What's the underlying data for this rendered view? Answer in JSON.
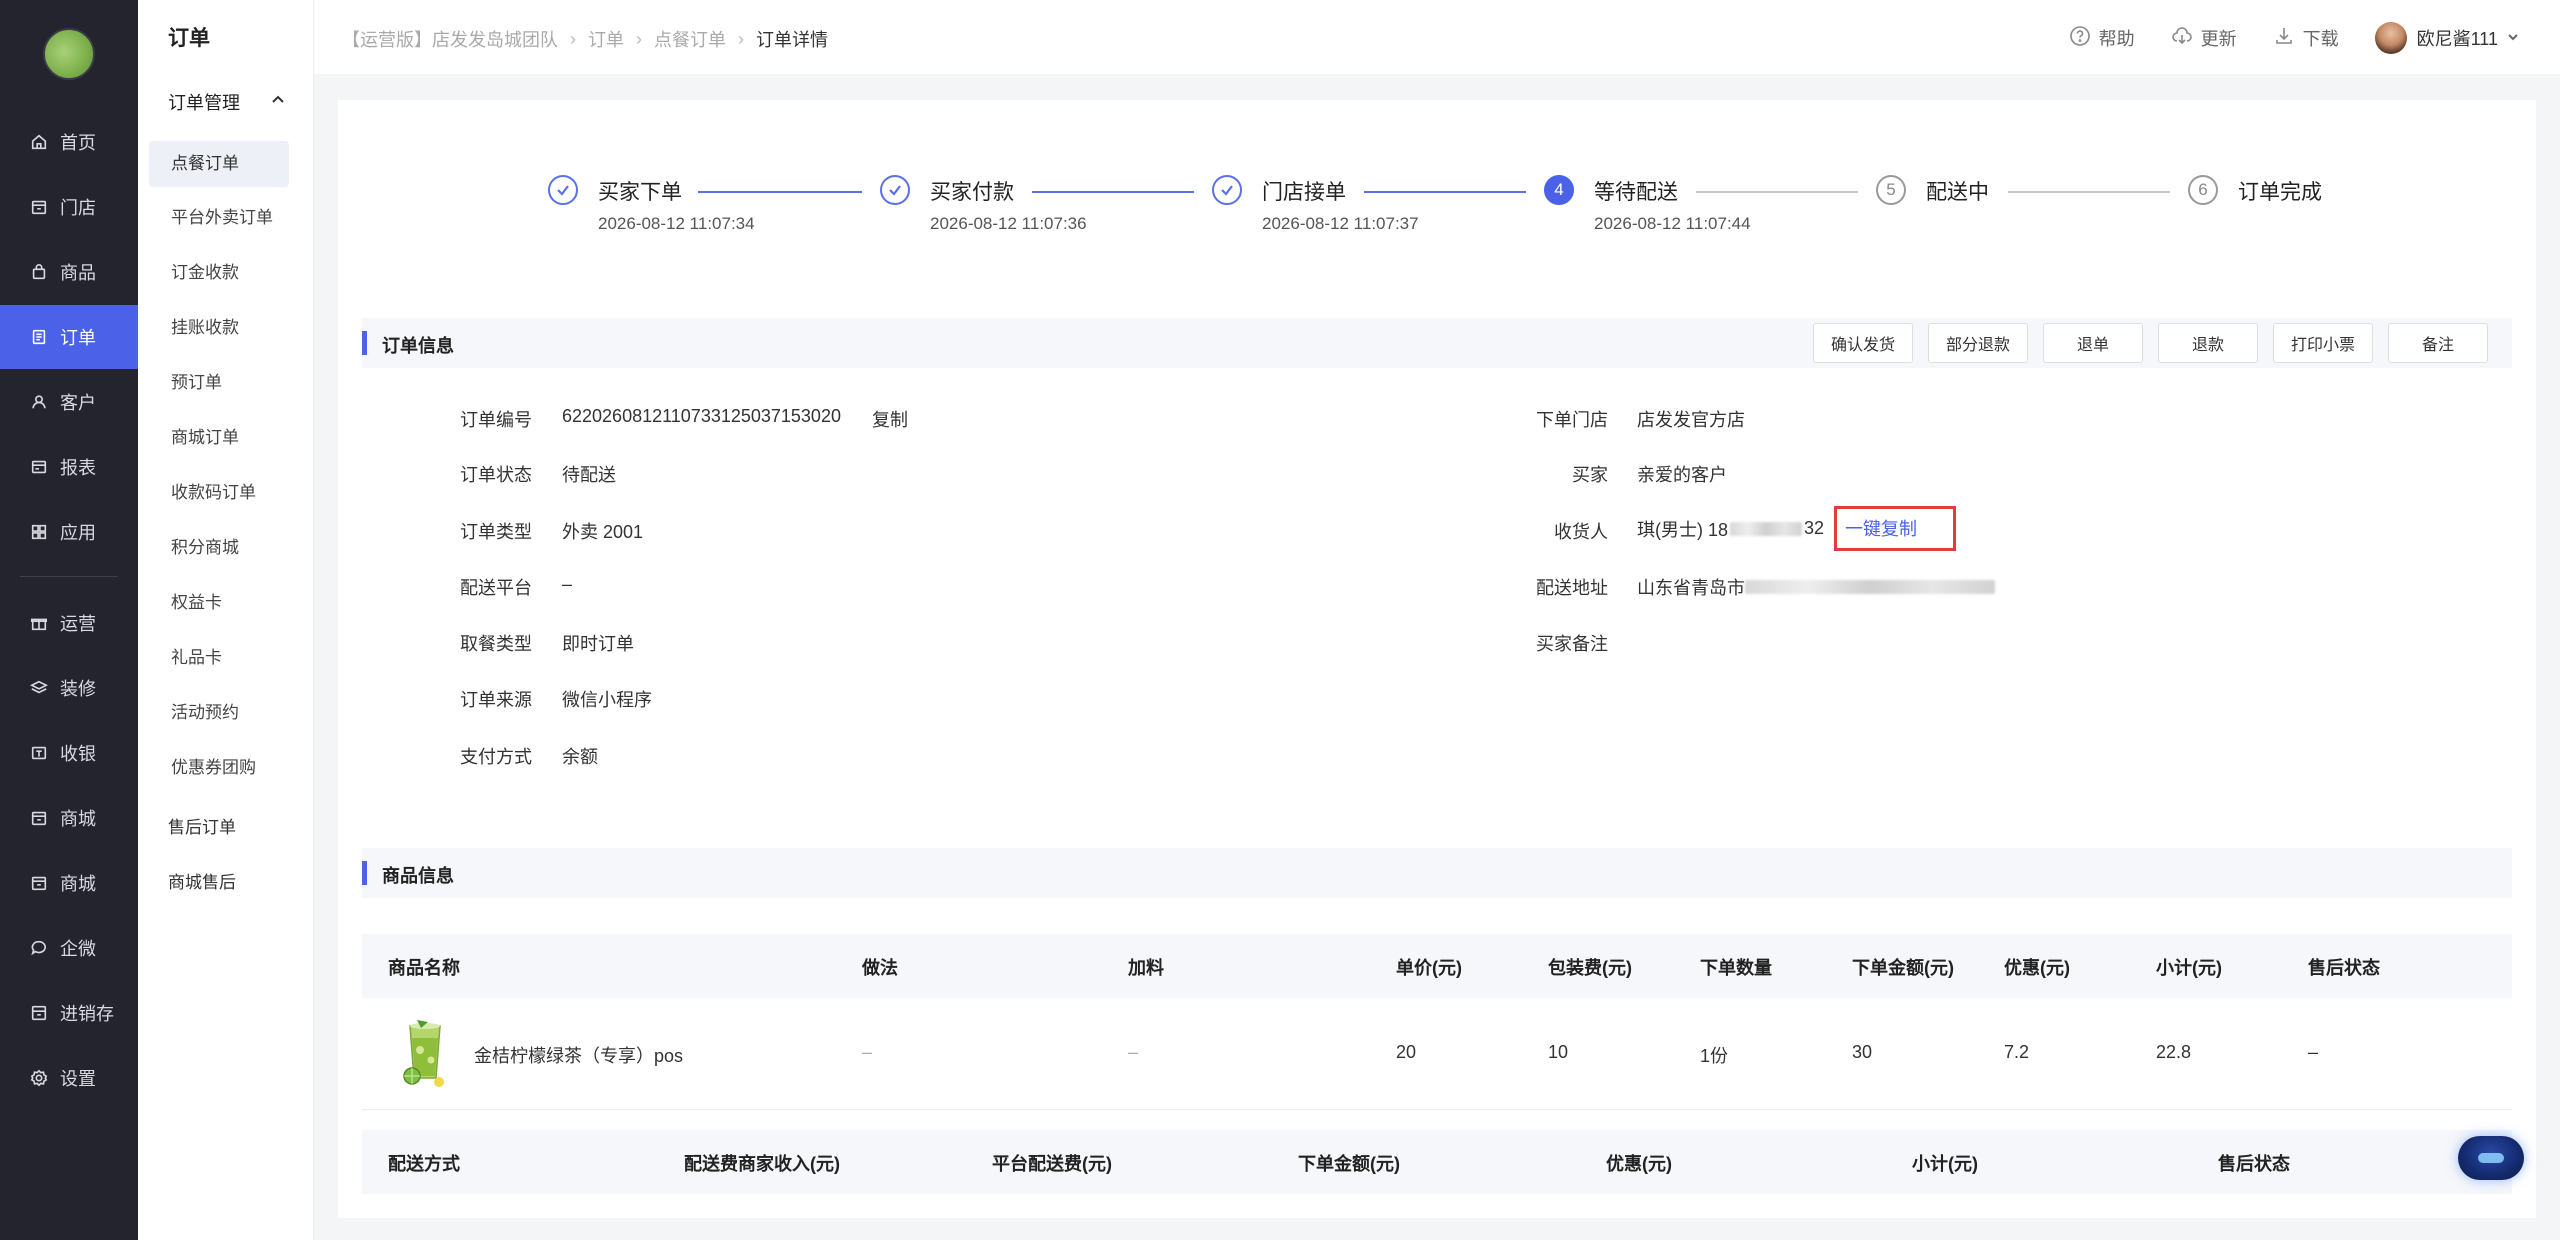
{
  "nav": {
    "items": [
      {
        "label": "首页",
        "icon": "home-icon"
      },
      {
        "label": "门店",
        "icon": "store-icon"
      },
      {
        "label": "商品",
        "icon": "bag-icon"
      },
      {
        "label": "订单",
        "icon": "order-icon"
      },
      {
        "label": "客户",
        "icon": "user-icon"
      },
      {
        "label": "报表",
        "icon": "report-icon"
      },
      {
        "label": "应用",
        "icon": "apps-icon"
      },
      {
        "label": "运营",
        "icon": "gift-icon"
      },
      {
        "label": "装修",
        "icon": "layers-icon"
      },
      {
        "label": "收银",
        "icon": "cashier-icon"
      },
      {
        "label": "商城",
        "icon": "mall-icon"
      },
      {
        "label": "商城",
        "icon": "mall-icon"
      },
      {
        "label": "企微",
        "icon": "chat-icon"
      },
      {
        "label": "进销存",
        "icon": "inventory-icon"
      },
      {
        "label": "设置",
        "icon": "settings-icon"
      }
    ],
    "active_index": 3
  },
  "submenu": {
    "title": "订单",
    "group": "订单管理",
    "items": [
      "点餐订单",
      "平台外卖订单",
      "订金收款",
      "挂账收款",
      "预订单",
      "商城订单",
      "收款码订单",
      "积分商城",
      "权益卡",
      "礼品卡",
      "活动预约",
      "优惠券团购"
    ],
    "extra": [
      "售后订单",
      "商城售后"
    ]
  },
  "header": {
    "breadcrumb": [
      "【运营版】店发发岛城团队",
      "订单",
      "点餐订单",
      "订单详情"
    ],
    "help": "帮助",
    "update": "更新",
    "download": "下载",
    "username": "欧尼酱111"
  },
  "steps": [
    {
      "label": "买家下单",
      "time": "2026-08-12 11:07:34",
      "status": "done"
    },
    {
      "label": "买家付款",
      "time": "2026-08-12 11:07:36",
      "status": "done"
    },
    {
      "label": "门店接单",
      "time": "2026-08-12 11:07:37",
      "status": "done"
    },
    {
      "label": "等待配送",
      "time": "2026-08-12 11:07:44",
      "status": "current",
      "num": "4"
    },
    {
      "label": "配送中",
      "time": "",
      "status": "todo",
      "num": "5"
    },
    {
      "label": "订单完成",
      "time": "",
      "status": "todo",
      "num": "6"
    }
  ],
  "order_info": {
    "title": "订单信息",
    "buttons": [
      "确认发货",
      "部分退款",
      "退单",
      "退款",
      "打印小票",
      "备注"
    ],
    "left": [
      {
        "k": "订单编号",
        "v": "62202608121107331250371530​20",
        "extra": "复制"
      },
      {
        "k": "订单状态",
        "v": "待配送"
      },
      {
        "k": "订单类型",
        "v": "外卖 2001"
      },
      {
        "k": "配送平台",
        "v": "–"
      },
      {
        "k": "取餐类型",
        "v": "即时订单"
      },
      {
        "k": "订单来源",
        "v": "微信小程序"
      },
      {
        "k": "支付方式",
        "v": "余额"
      }
    ],
    "right": [
      {
        "k": "下单门店",
        "v": "店发发官方店"
      },
      {
        "k": "买家",
        "v": "亲爱的客户"
      },
      {
        "k": "收货人",
        "v": "琪(男士) 18",
        "v2": "32",
        "extra": "一键复制"
      },
      {
        "k": "配送地址",
        "v": "山东省青岛市"
      },
      {
        "k": "买家备注",
        "v": ""
      }
    ]
  },
  "product_info": {
    "title": "商品信息",
    "columns": [
      "商品名称",
      "做法",
      "加料",
      "单价(元)",
      "包装费(元)",
      "下单数量",
      "下单金额(元)",
      "优惠(元)",
      "小计(元)",
      "售后状态"
    ],
    "rows": [
      {
        "name": "金桔柠檬绿茶（专享）pos",
        "method": "–",
        "extra": "–",
        "price": "20",
        "pack": "10",
        "qty": "1份",
        "amount": "30",
        "discount": "7.2",
        "subtotal": "22.8",
        "after": "–"
      }
    ],
    "footer_columns": [
      "配送方式",
      "配送费商家收入(元)",
      "平台配送费(元)",
      "下单金额(元)",
      "优惠(元)",
      "小计(元)",
      "售后状态"
    ]
  },
  "colors": {
    "accent": "#4a61e8",
    "nav_bg": "#23242e",
    "highlight_box": "#e33c3c"
  }
}
